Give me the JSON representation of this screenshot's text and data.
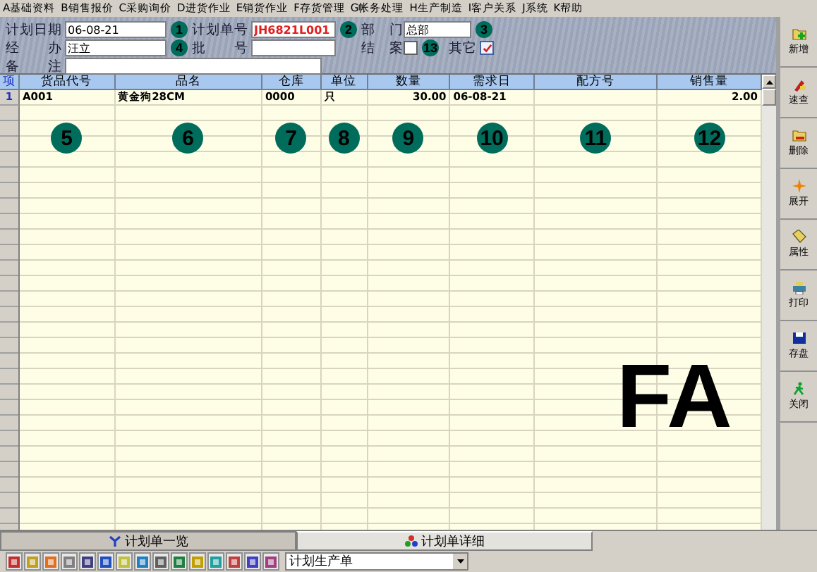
{
  "menu": [
    "A基础资料",
    "B销售报价",
    "C采购询价",
    "D进货作业",
    "E销货作业",
    "F存货管理",
    "G帐务处理",
    "H生产制造",
    "I客户关系",
    "J系统",
    "K帮助"
  ],
  "form": {
    "plan_date_label": "计划日期",
    "plan_date": "06-08-21",
    "plan_no_label": "计划单号",
    "plan_no": "JH6821L001",
    "dept_label": "部　门",
    "dept": "总部",
    "handler_label": "经　　办",
    "handler": "汪立",
    "batch_label": "批　　号",
    "closed_label": "结　案",
    "closed": false,
    "other_label": "其它",
    "other": true,
    "note_label": "备　　注"
  },
  "table": {
    "columns": [
      "项",
      "货品代号",
      "品名",
      "仓库",
      "单位",
      "数量",
      "需求日",
      "配方号",
      "销售量"
    ],
    "rows": [
      [
        "1",
        "A001",
        "黄金狗28CM",
        "0000",
        "只",
        "30.00",
        "06-08-21",
        "",
        "2.00"
      ]
    ]
  },
  "toolbar": [
    "新增",
    "速查",
    "删除",
    "展开",
    "属性",
    "打印",
    "存盘",
    "关闭"
  ],
  "tabs": [
    {
      "label": "计划单一览",
      "selected": false
    },
    {
      "label": "计划单详细",
      "selected": true
    }
  ],
  "combo": {
    "value": "计划生产单"
  },
  "overlay_text": "FA",
  "callouts": [
    "1",
    "2",
    "3",
    "4",
    "5",
    "6",
    "7",
    "8",
    "9",
    "10",
    "11",
    "12",
    "13"
  ]
}
